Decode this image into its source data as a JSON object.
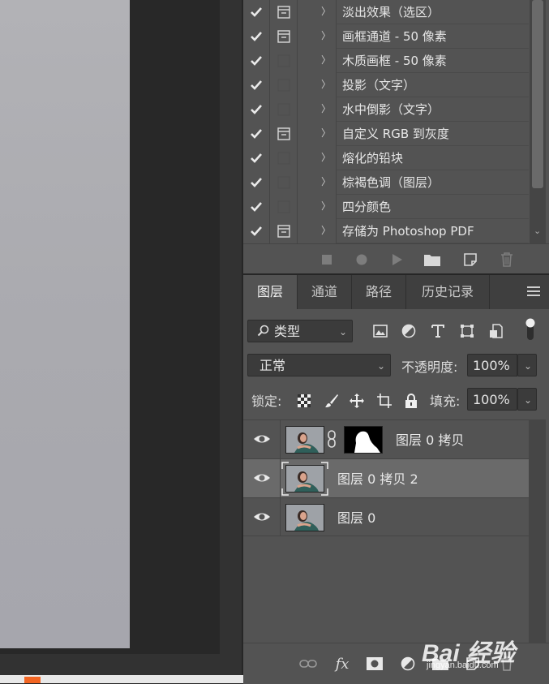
{
  "actions": {
    "items": [
      {
        "label": "淡出效果（选区）",
        "checked": true,
        "has_dialog": true
      },
      {
        "label": "画框通道 - 50 像素",
        "checked": true,
        "has_dialog": true
      },
      {
        "label": "木质画框 - 50 像素",
        "checked": true,
        "has_dialog": false
      },
      {
        "label": "投影（文字）",
        "checked": true,
        "has_dialog": false
      },
      {
        "label": "水中倒影（文字）",
        "checked": true,
        "has_dialog": false
      },
      {
        "label": "自定义 RGB 到灰度",
        "checked": true,
        "has_dialog": true
      },
      {
        "label": "熔化的铅块",
        "checked": true,
        "has_dialog": false
      },
      {
        "label": "棕褐色调（图层）",
        "checked": true,
        "has_dialog": false
      },
      {
        "label": "四分颜色",
        "checked": true,
        "has_dialog": false
      },
      {
        "label": "存储为 Photoshop PDF",
        "checked": true,
        "has_dialog": true
      }
    ],
    "caret": "〉",
    "footer_icons": [
      "stop-icon",
      "record-icon",
      "play-icon",
      "new-set-folder-icon",
      "new-action-icon",
      "delete-icon"
    ]
  },
  "layers_panel": {
    "tabs": [
      "图层",
      "通道",
      "路径",
      "历史记录"
    ],
    "active_tab": 0,
    "filter": {
      "label": "类型",
      "icons": [
        "image-filter-icon",
        "adjustment-filter-icon",
        "type-filter-icon",
        "shape-filter-icon",
        "smart-object-filter-icon"
      ]
    },
    "blend_mode": "正常",
    "opacity_label": "不透明度:",
    "opacity_value": "100%",
    "lock_label": "锁定:",
    "fill_label": "填充:",
    "fill_value": "100%",
    "layers": [
      {
        "name": "图层 0 拷贝",
        "visible": true,
        "has_mask": true,
        "selected": false
      },
      {
        "name": "图层 0 拷贝 2",
        "visible": true,
        "has_mask": false,
        "selected": true
      },
      {
        "name": "图层 0",
        "visible": true,
        "has_mask": false,
        "selected": false
      }
    ],
    "footer_icons": [
      "link-layers-icon",
      "fx-icon",
      "add-mask-icon",
      "adjustment-layer-icon",
      "group-icon",
      "new-layer-icon",
      "delete-layer-icon"
    ],
    "fx_label": "fx"
  },
  "watermark": {
    "text": "Bai 经验",
    "url": "jingyan.baidu.com"
  },
  "colors": {
    "panel": "#535353",
    "selected_row": "#6a6a6a",
    "canvas": "#aeaeb3"
  }
}
